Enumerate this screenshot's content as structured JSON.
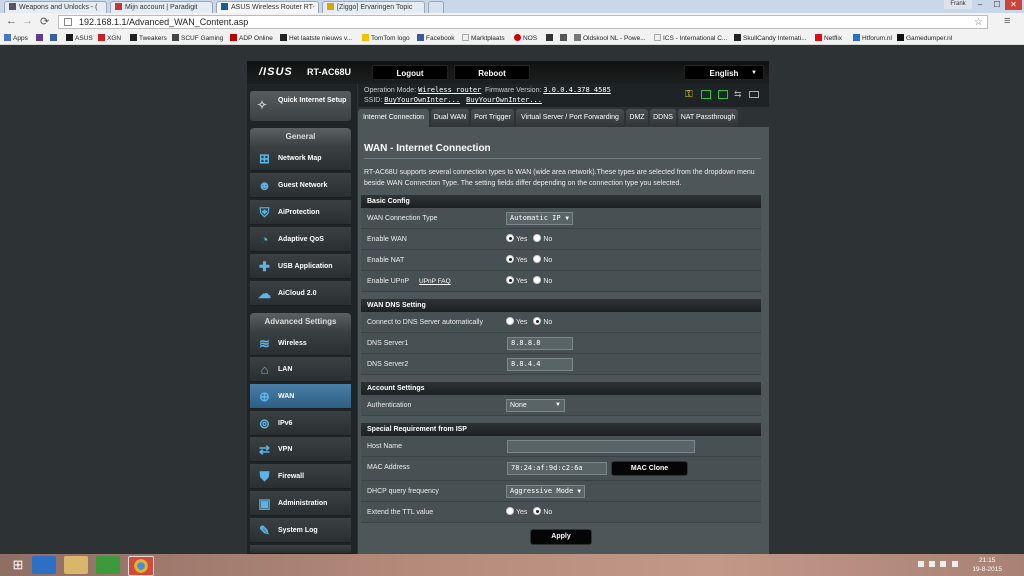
{
  "browser": {
    "tabs": [
      {
        "label": "Weapons and Unlocks - ("
      },
      {
        "label": "Mijn account | Paradigit"
      },
      {
        "label": "ASUS Wireless Router RT-"
      },
      {
        "label": "[Ziggo] Ervaringen Topic"
      }
    ],
    "profile": "Frank",
    "window_controls": {
      "minimize": "–",
      "maximize": "☐",
      "close": "✕"
    },
    "nav": {
      "back": "←",
      "forward": "→",
      "reload": "⟳",
      "menu": "≡",
      "star": "☆"
    },
    "url": "192.168.1.1/Advanced_WAN_Content.asp",
    "bookmarks": [
      "Apps",
      "ASUS",
      "XGN",
      "Tweakers",
      "SCUF Gaming",
      "ADP Online",
      "Het laatste nieuws v...",
      "TomTom logo",
      "Facebook",
      "Marktplaats",
      "NOS",
      "Oldskool NL - Powe...",
      "ICS - International C...",
      "SkullCandy Internati...",
      "Netflix",
      "Htforum.nl",
      "Gamedumper.nl"
    ]
  },
  "router": {
    "brand": "/ISUS",
    "model": "RT-AC68U",
    "logout": "Logout",
    "reboot": "Reboot",
    "language": "English",
    "operation_mode_label": "Operation Mode:",
    "operation_mode_value": "Wireless router",
    "firmware_label": "Firmware Version:",
    "firmware_value": "3.0.0.4.378_4585",
    "ssid_label": "SSID:",
    "ssid_1": "BuyYourOwnInter...",
    "ssid_2": "BuyYourOwnInter...",
    "quick_setup": "Quick Internet Setup",
    "general_title": "General",
    "general_items": [
      "Network Map",
      "Guest Network",
      "AiProtection",
      "Adaptive QoS",
      "USB Application",
      "AiCloud 2.0"
    ],
    "advanced_title": "Advanced Settings",
    "advanced_items": [
      "Wireless",
      "LAN",
      "WAN",
      "IPv6",
      "VPN",
      "Firewall",
      "Administration",
      "System Log"
    ],
    "tabs": [
      "Internet Connection",
      "Dual WAN",
      "Port Trigger",
      "Virtual Server / Port Forwarding",
      "DMZ",
      "DDNS",
      "NAT Passthrough"
    ]
  },
  "content": {
    "title": "WAN - Internet Connection",
    "description": "RT-AC68U supports several connection types to WAN (wide area network).These types are selected from the dropdown menu beside WAN Connection Type. The setting fields differ depending on the connection type you selected.",
    "yes": "Yes",
    "no": "No",
    "basic": {
      "header": "Basic Config",
      "wan_type_label": "WAN Connection Type",
      "wan_type_value": "Automatic IP",
      "enable_wan": "Enable WAN",
      "enable_nat": "Enable NAT",
      "enable_upnp": "Enable UPnP",
      "upnp_faq": "UPnP FAQ"
    },
    "dns": {
      "header": "WAN DNS Setting",
      "auto_label": "Connect to DNS Server automatically",
      "server1_label": "DNS Server1",
      "server1_value": "8.8.8.8",
      "server2_label": "DNS Server2",
      "server2_value": "8.8.4.4"
    },
    "account": {
      "header": "Account Settings",
      "auth_label": "Authentication",
      "auth_value": "None"
    },
    "special": {
      "header": "Special Requirement from ISP",
      "host_label": "Host Name",
      "host_value": "",
      "mac_label": "MAC Address",
      "mac_value": "78:24:af:9d:c2:6a",
      "mac_clone": "MAC Clone",
      "dhcp_label": "DHCP query frequency",
      "dhcp_value": "Aggressive Mode",
      "ttl_label": "Extend the TTL value"
    },
    "apply": "Apply"
  },
  "taskbar": {
    "time": "21:15",
    "date": "19-8-2015"
  },
  "colors": {
    "accent_blue": "#5cb4e6",
    "content_bg": "#4d5759",
    "active_menu": "#2e5e84"
  }
}
